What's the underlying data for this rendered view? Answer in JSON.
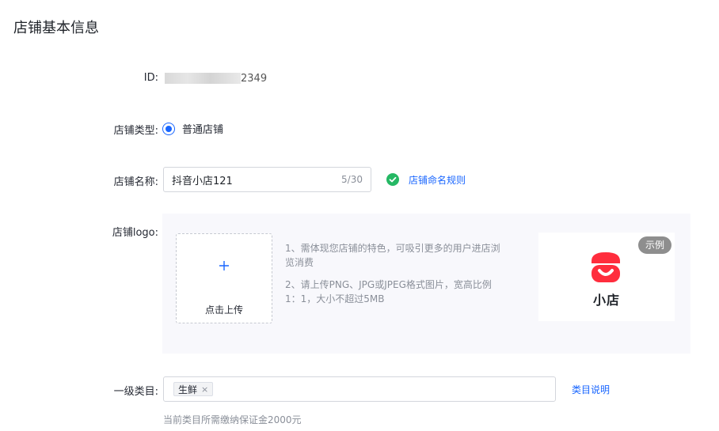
{
  "page": {
    "title": "店铺基本信息"
  },
  "id_row": {
    "label": "ID",
    "colon": ":",
    "visible_suffix": "2349"
  },
  "shop_type": {
    "label": "店铺类型",
    "colon": ":",
    "selected_option": "普通店铺",
    "selected": true
  },
  "shop_name": {
    "label": "店铺名称",
    "colon": ":",
    "value": "抖音小店121",
    "counter": "5/30",
    "rule_link": "店铺命名规则",
    "valid_icon": "check-circle-icon"
  },
  "shop_logo": {
    "label": "店铺logo",
    "colon": ":",
    "upload_icon": "plus-icon",
    "upload_text": "点击上传",
    "hints": [
      "1、需体现您店铺的特色，可吸引更多的用户进店浏览消费",
      "2、请上传PNG、JPG或JPEG格式图片，宽高比例1：1，大小不超过5MB"
    ],
    "example_badge": "示例",
    "example_logo_text": "小店"
  },
  "category": {
    "label": "一级类目",
    "colon": ":",
    "tags": [
      {
        "text": "生鲜",
        "close": "×"
      }
    ],
    "link": "类目说明",
    "deposit_note": "当前类目所需缴纳保证金2000元"
  },
  "colors": {
    "accent": "#1966ff",
    "success": "#25b864",
    "logo_red": "#ff2d3d",
    "panel_bg": "#f8f8fc"
  }
}
